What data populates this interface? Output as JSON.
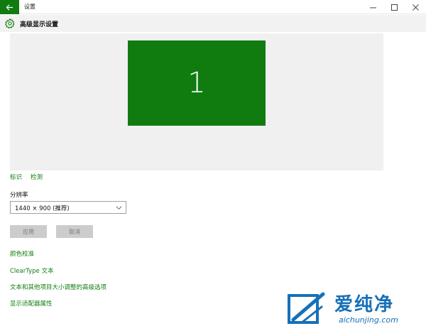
{
  "window": {
    "title": "设置",
    "back_icon": "arrow-left-icon",
    "controls": [
      "minimize-icon",
      "maximize-icon",
      "close-icon"
    ]
  },
  "header": {
    "icon": "gear-icon",
    "title": "高级显示设置"
  },
  "preview": {
    "monitor_number": "1",
    "monitor_color": "#107c10"
  },
  "links": {
    "identify": "标识",
    "detect": "检测"
  },
  "resolution": {
    "label": "分辨率",
    "value": "1440 × 900 (推荐)"
  },
  "buttons": {
    "apply": "应用",
    "cancel": "取消"
  },
  "related_links": [
    "颜色校准",
    "ClearType 文本",
    "文本和其他项目大小调整的高级选项",
    "显示适配器属性"
  ],
  "watermark": {
    "text": "爱纯净",
    "url": "aichunjing.com"
  },
  "colors": {
    "accent": "#107c10",
    "watermark": "#1670b8"
  }
}
